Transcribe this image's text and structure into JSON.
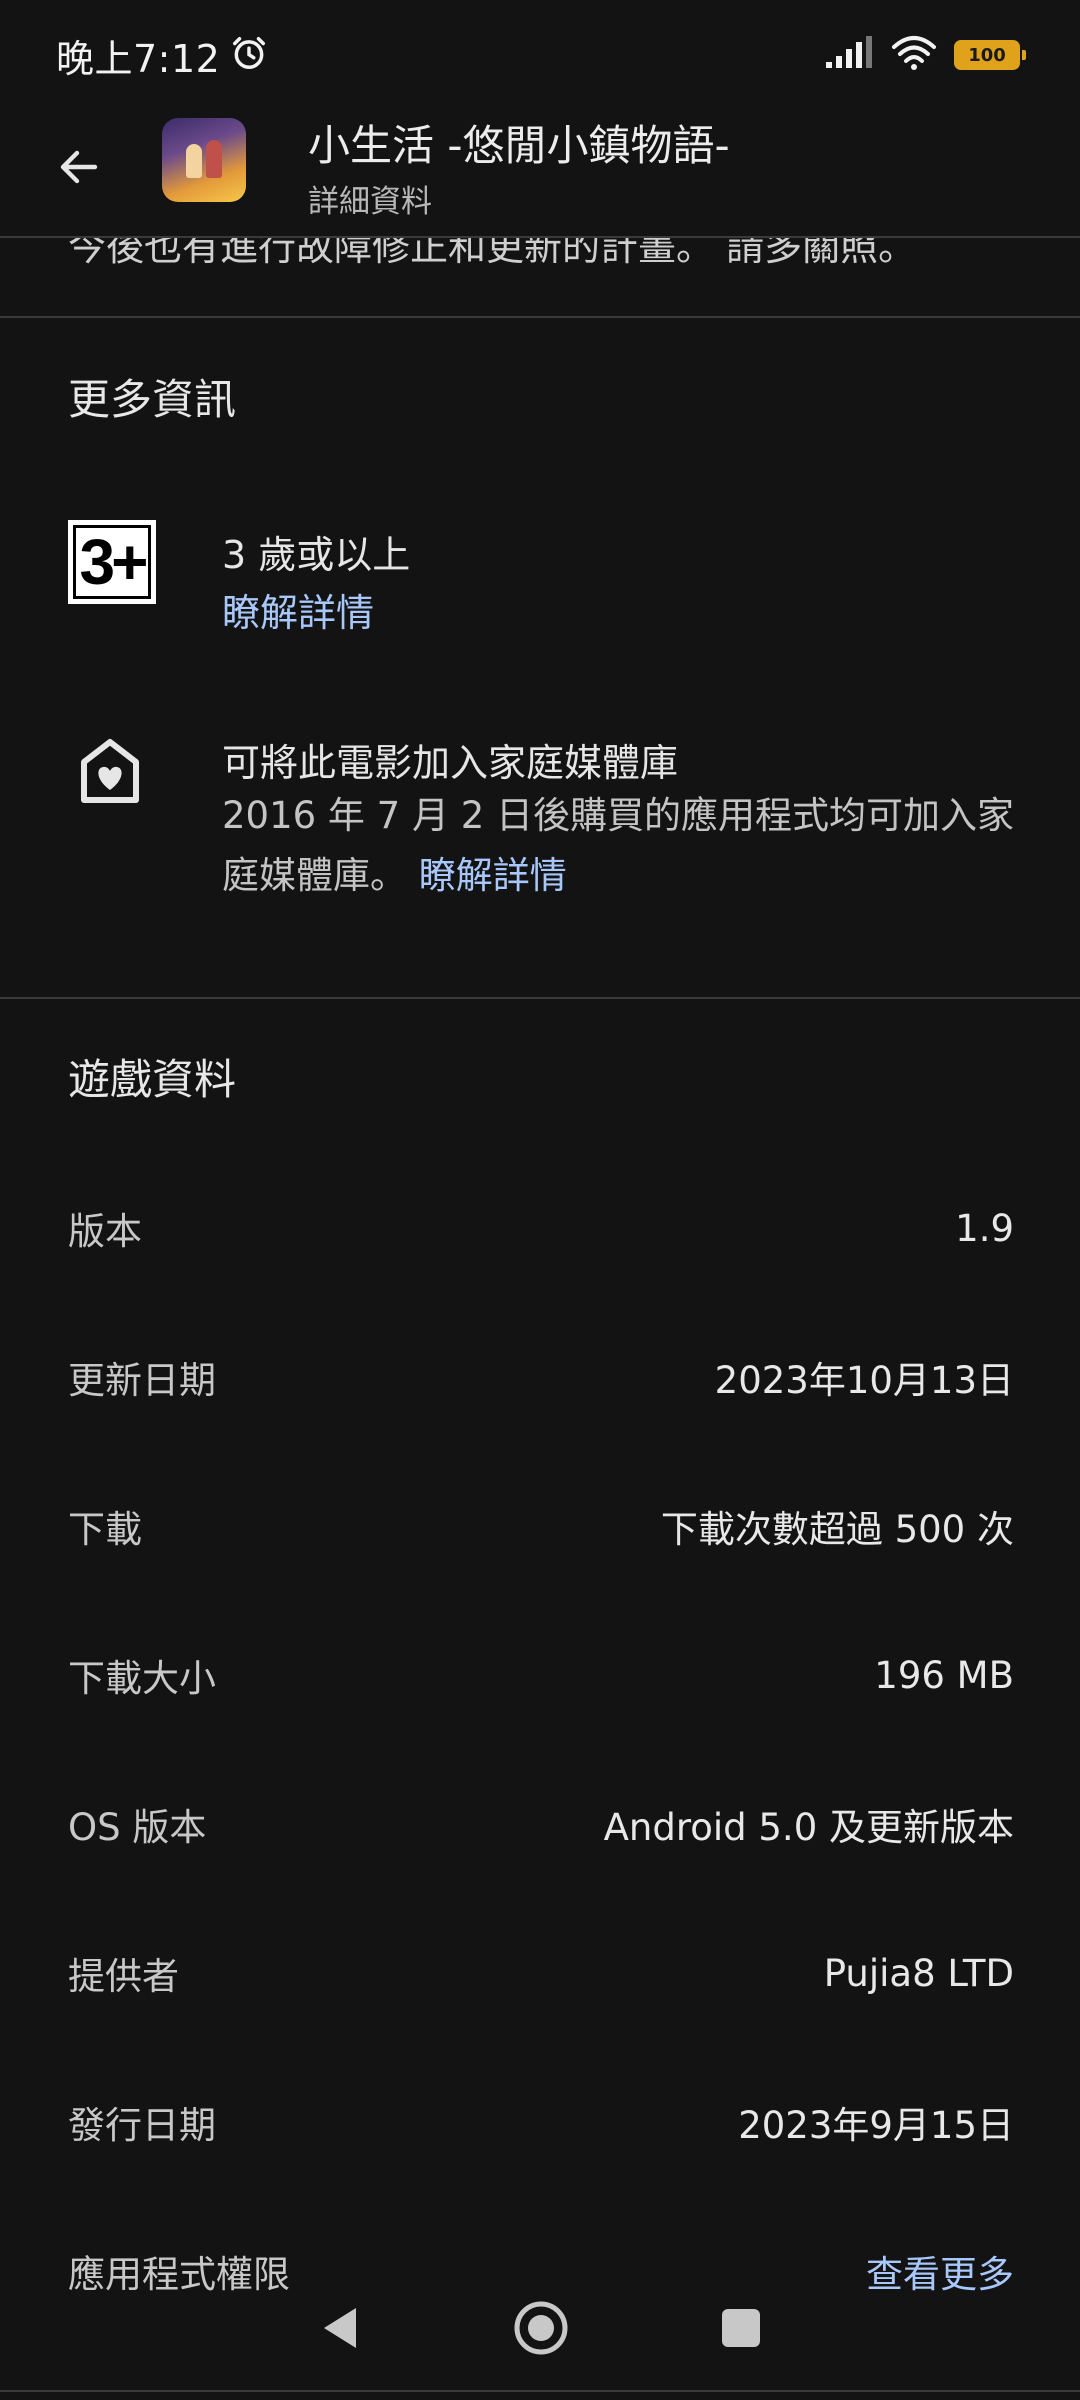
{
  "status_bar": {
    "time": "晚上7:12",
    "battery": "100"
  },
  "app_bar": {
    "title": "小生活 -悠閒小鎮物語-",
    "subtitle": "詳細資料"
  },
  "partial_text": "今後也有進行故障修正和更新的計畫。 請多關照。",
  "more_info": {
    "heading": "更多資訊",
    "rating_badge": "3+",
    "rating_text": "3 歲或以上",
    "rating_link": "瞭解詳情",
    "family_title": "可將此電影加入家庭媒體庫",
    "family_body": "2016 年 7 月 2 日後購買的應用程式均可加入家庭媒體庫。",
    "family_link": "瞭解詳情"
  },
  "game_info": {
    "heading": "遊戲資料",
    "rows": [
      {
        "label": "版本",
        "value": "1.9"
      },
      {
        "label": "更新日期",
        "value": "2023年10月13日"
      },
      {
        "label": "下載",
        "value": "下載次數超過 500 次"
      },
      {
        "label": "下載大小",
        "value": "196 MB"
      },
      {
        "label": "OS 版本",
        "value": "Android 5.0 及更新版本"
      },
      {
        "label": "提供者",
        "value": "Pujia8 LTD"
      },
      {
        "label": "發行日期",
        "value": "2023年9月15日"
      },
      {
        "label": "應用程式權限",
        "value": "查看更多"
      }
    ]
  },
  "colors": {
    "background": "#131313",
    "link": "#a8c7fa",
    "battery": "#e0a21a"
  },
  "icons": [
    "alarm-icon",
    "signal-icon",
    "wifi-icon",
    "battery-icon",
    "back-arrow-icon",
    "family-library-icon",
    "nav-back-icon",
    "nav-home-icon",
    "nav-recents-icon"
  ]
}
